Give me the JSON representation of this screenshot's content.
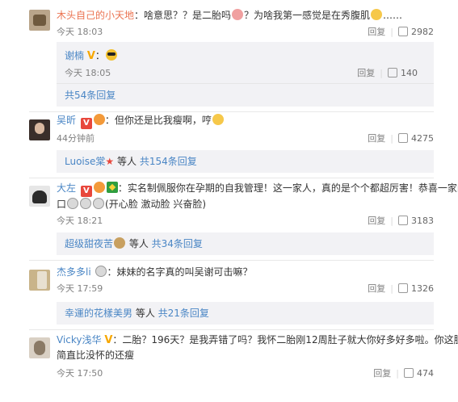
{
  "common": {
    "reply_label": "回复",
    "sep": "|"
  },
  "comments": [
    {
      "user": "木头自己的小天地",
      "text": "：啥意思？？是二胎吗",
      "text_after": "？为啥我第一感觉是在秀腹肌",
      "text_tail": "……",
      "time": "今天 18:03",
      "likes": "2982",
      "sub": {
        "user": "谢楠",
        "badge": "V",
        "text": "：",
        "time": "今天 18:05",
        "likes": "140"
      },
      "more": "共54条回复"
    },
    {
      "user": "吴昕",
      "badge_red": "V",
      "text": "：但你还是比我瘦啊，哼",
      "time": "44分钟前",
      "likes": "4275",
      "more_user": "Luoise棠",
      "more_mid": " 等人 ",
      "more": "共154条回复"
    },
    {
      "user": "大左",
      "badge_red": "V",
      "text": "：实名制佩服你在孕期的自我管理！这一家人，真的是个个都超厉害！恭喜一家四",
      "text_line2_a": "口",
      "text_line2_b": "(开心脸 激动脸 兴奋脸)",
      "time": "今天 18:21",
      "likes": "3183",
      "more_user": "超级甜夜苦",
      "more_mid": " 等人 ",
      "more": "共34条回复"
    },
    {
      "user": "杰多多li",
      "text": "：妹妹的名字真的叫吴谢可击嘛？",
      "time": "今天 17:59",
      "likes": "1326",
      "more_user": "幸運的花樣美男",
      "more_mid": " 等人 ",
      "more": "共21条回复"
    },
    {
      "user": "Vicky浅华",
      "badge": "V",
      "text": "：二胎？196天？是我弄错了吗？我怀二胎刚12周肚子就大你好多好多啦。你这肚子",
      "text_line2": "简直比没怀的还瘦",
      "time": "今天 17:50",
      "likes": "474"
    }
  ]
}
